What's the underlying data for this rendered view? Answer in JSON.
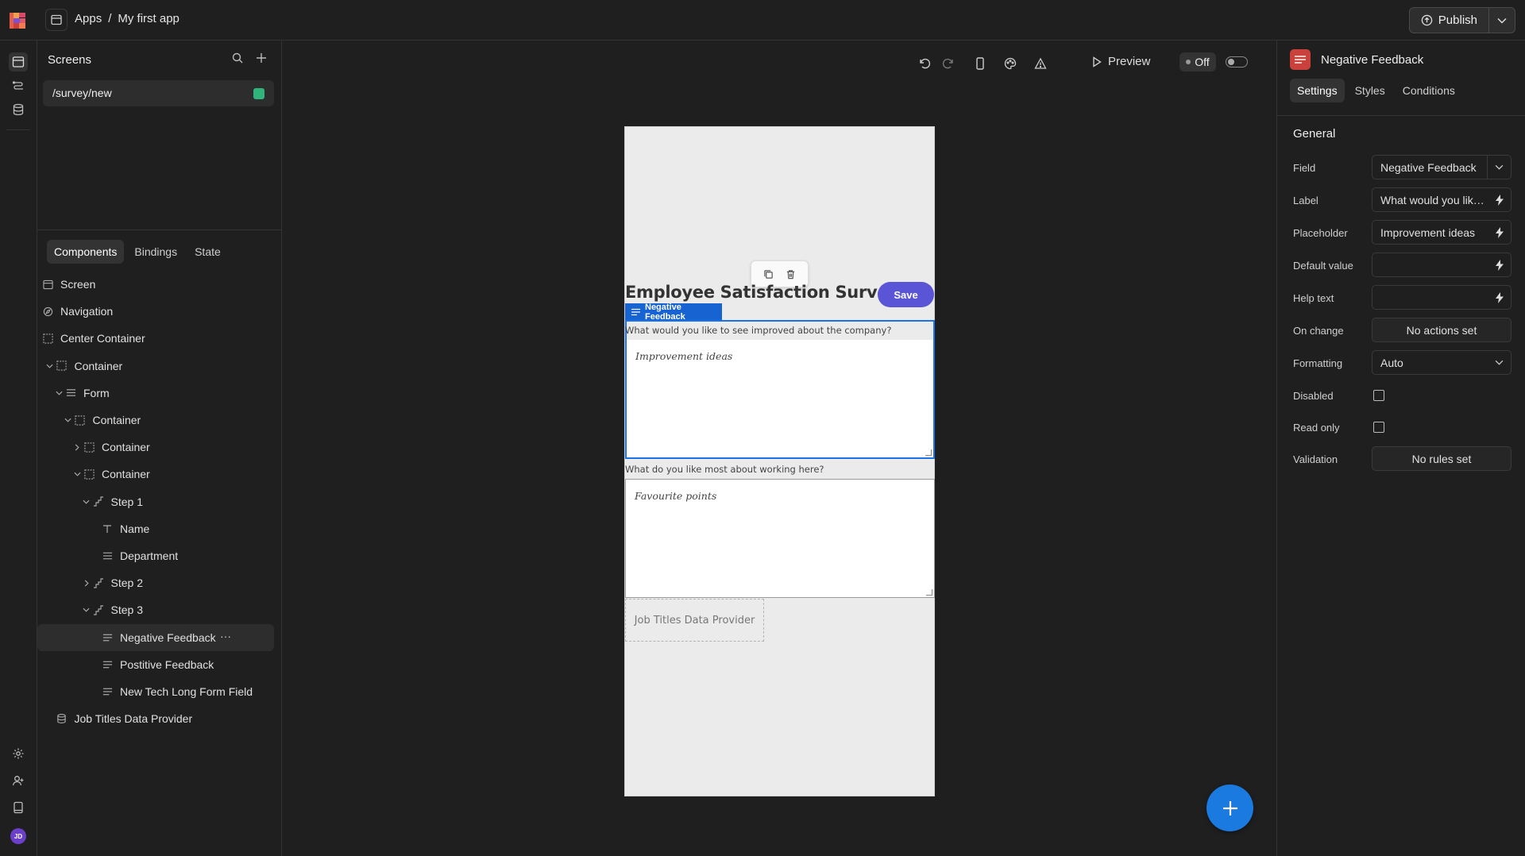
{
  "breadcrumb": {
    "root": "Apps",
    "separator": "/",
    "current": "My first app"
  },
  "publish": {
    "label": "Publish"
  },
  "screens": {
    "title": "Screens",
    "items": [
      {
        "label": "/survey/new"
      }
    ]
  },
  "left_tabs": [
    "Components",
    "Bindings",
    "State"
  ],
  "tree": [
    {
      "label": "Screen",
      "depth": 0,
      "icon": "screen-icon",
      "chevron": "none"
    },
    {
      "label": "Navigation",
      "depth": 0,
      "icon": "navigation-icon",
      "chevron": "none"
    },
    {
      "label": "Center Container",
      "depth": 0,
      "icon": "container-icon",
      "chevron": "none"
    },
    {
      "label": "Container",
      "depth": 1,
      "icon": "container-icon",
      "chevron": "down"
    },
    {
      "label": "Form",
      "depth": 2,
      "icon": "form-icon",
      "chevron": "down"
    },
    {
      "label": "Container",
      "depth": 3,
      "icon": "container-icon",
      "chevron": "down"
    },
    {
      "label": "Container",
      "depth": 4,
      "icon": "container-icon",
      "chevron": "right"
    },
    {
      "label": "Container",
      "depth": 4,
      "icon": "container-icon",
      "chevron": "down"
    },
    {
      "label": "Step 1",
      "depth": 5,
      "icon": "step-icon",
      "chevron": "down"
    },
    {
      "label": "Name",
      "depth": 6,
      "icon": "text-icon",
      "chevron": "none"
    },
    {
      "label": "Department",
      "depth": 6,
      "icon": "options-icon",
      "chevron": "none"
    },
    {
      "label": "Step 2",
      "depth": 5,
      "icon": "step-icon",
      "chevron": "right"
    },
    {
      "label": "Step 3",
      "depth": 5,
      "icon": "step-icon",
      "chevron": "down"
    },
    {
      "label": "Negative Feedback",
      "depth": 6,
      "icon": "longform-icon",
      "chevron": "none",
      "selected": true
    },
    {
      "label": "Postitive Feedback",
      "depth": 6,
      "icon": "longform-icon",
      "chevron": "none"
    },
    {
      "label": "New Tech Long Form Field",
      "depth": 6,
      "icon": "longform-icon",
      "chevron": "none"
    },
    {
      "label": "Job Titles Data Provider",
      "depth": 1,
      "icon": "database-icon",
      "chevron": "none"
    }
  ],
  "toolbar": {
    "preview_label": "Preview",
    "off_label": "Off"
  },
  "preview": {
    "title": "Employee Satisfaction Survey",
    "save_label": "Save",
    "selected_tag": "Negative Feedback",
    "field1_label": "What would you like to see improved about the company?",
    "field1_placeholder": "Improvement ideas",
    "field2_label": "What do you like most about working here?",
    "field2_placeholder": "Favourite points",
    "data_provider": "Job Titles Data Provider"
  },
  "inspector": {
    "title": "Negative Feedback",
    "tabs": [
      "Settings",
      "Styles",
      "Conditions"
    ],
    "section": "General",
    "field": {
      "label": "Field",
      "value": "Negative Feedback"
    },
    "label": {
      "label": "Label",
      "value": "What would you like..."
    },
    "placeholder": {
      "label": "Placeholder",
      "value": "Improvement ideas"
    },
    "default_value": {
      "label": "Default value",
      "value": ""
    },
    "help_text": {
      "label": "Help text",
      "value": ""
    },
    "on_change": {
      "label": "On change",
      "value": "No actions set"
    },
    "formatting": {
      "label": "Formatting",
      "value": "Auto"
    },
    "disabled": {
      "label": "Disabled",
      "checked": false
    },
    "read_only": {
      "label": "Read only",
      "checked": false
    },
    "validation": {
      "label": "Validation",
      "value": "No rules set"
    }
  },
  "colors": {
    "accent": "#5a55d6",
    "selection": "#1a73e8",
    "fab": "#1a7ae0",
    "screen_badge": "#2fb57c",
    "brand": "#c9413a"
  }
}
